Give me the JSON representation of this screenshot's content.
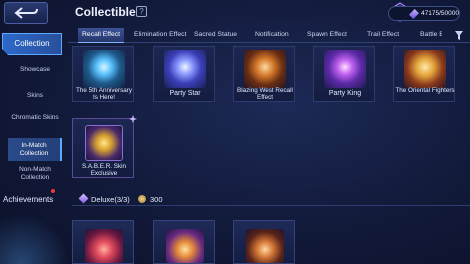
{
  "header": {
    "title": "Collectible",
    "points": "47175/50000",
    "back_icon": "back-arrow-icon",
    "help_icon": "question-icon"
  },
  "sidebar": {
    "items": [
      {
        "label": "Collection"
      },
      {
        "label": "Showcase"
      },
      {
        "label": "Skins"
      },
      {
        "label": "Chromatic Skins"
      },
      {
        "label": "In-Match Collection"
      },
      {
        "label": "Non-Match Collection"
      }
    ],
    "achievements": "Achievements"
  },
  "tabs": [
    {
      "label": "Recall Effect"
    },
    {
      "label": "Elimination Effect"
    },
    {
      "label": "Sacred Statue"
    },
    {
      "label": "Notification"
    },
    {
      "label": "Spawn Effect"
    },
    {
      "label": "Trail Effect"
    },
    {
      "label": "Battle E"
    }
  ],
  "cards": [
    {
      "label": "The 5th Anniversary Is Here!"
    },
    {
      "label": "Party Star"
    },
    {
      "label": "Blazing West Recall Effect"
    },
    {
      "label": "Party King"
    },
    {
      "label": "The Oriental Fighters"
    },
    {
      "label": "S.A.B.E.R. Skin Exclusive"
    }
  ],
  "deluxe": {
    "label": "Deluxe(3/3)",
    "count": "300"
  },
  "colors": {
    "accent": "#5ea8ff",
    "background": "#121a3a"
  }
}
